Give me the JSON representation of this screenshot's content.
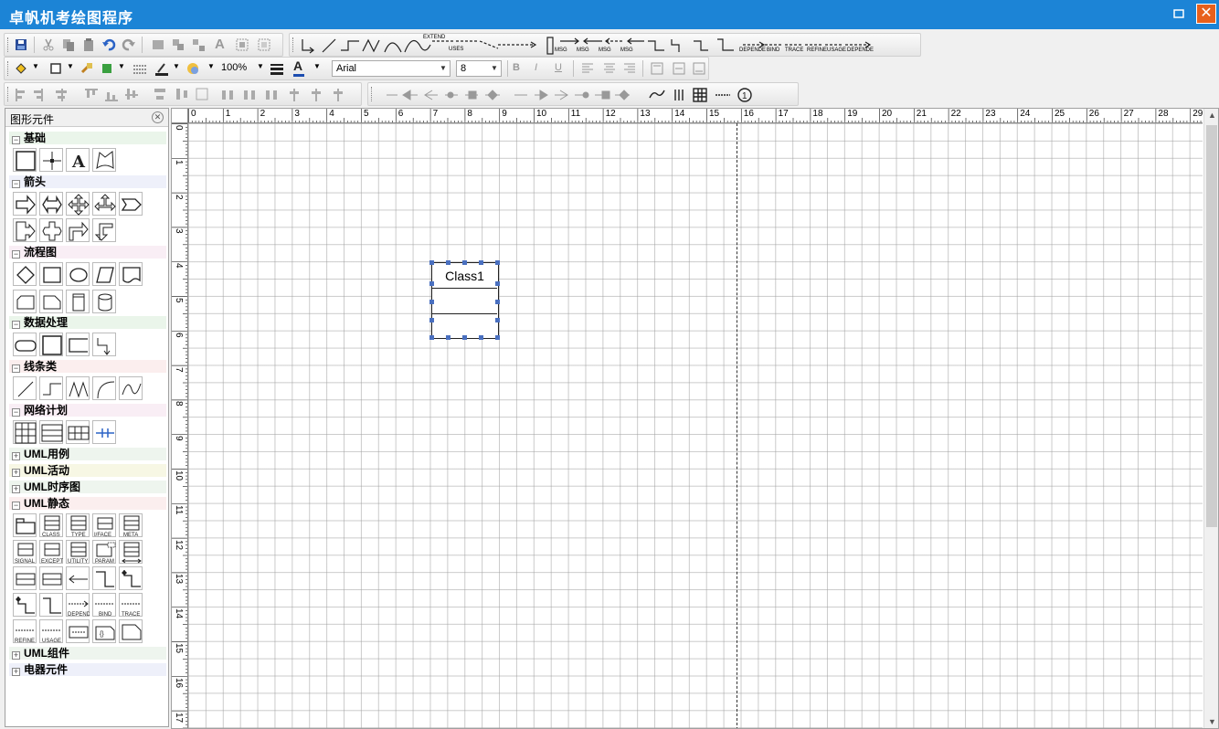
{
  "window": {
    "title": "卓帆机考绘图程序",
    "minimize_glyph": "—",
    "close_glyph": "✕"
  },
  "toolbar": {
    "zoom": "100%",
    "font_name": "Arial",
    "font_size": "8",
    "bold": "B",
    "italic": "I",
    "underline": "U",
    "text_color_glyph": "A",
    "connectors": {
      "extend": "EXTEND",
      "uses": "USES",
      "msg": "MSG",
      "depend": "DEPENDE",
      "bind": "BIND",
      "trace": "TRACE",
      "refine": "REFINE",
      "usage": "USAGE",
      "depend2": "DEPENDE"
    }
  },
  "panel": {
    "title": "图形元件",
    "close_glyph": "✕",
    "categories": [
      {
        "label": "基础",
        "expanded": true
      },
      {
        "label": "箭头",
        "expanded": true
      },
      {
        "label": "流程图",
        "expanded": true
      },
      {
        "label": "数据处理",
        "expanded": true
      },
      {
        "label": "线条类",
        "expanded": true
      },
      {
        "label": "网络计划",
        "expanded": true
      },
      {
        "label": "UML用例",
        "expanded": false
      },
      {
        "label": "UML活动",
        "expanded": false
      },
      {
        "label": "UML时序图",
        "expanded": false
      },
      {
        "label": "UML静态",
        "expanded": true
      },
      {
        "label": "UML组件",
        "expanded": false
      },
      {
        "label": "电器元件",
        "expanded": false
      }
    ],
    "expand_glyph": "+",
    "collapse_glyph": "−",
    "uml_static_labels": [
      "CLASS",
      "TYPE",
      "I/FACE",
      "META",
      "SIGNAL",
      "EXCEPT",
      "UTILITY",
      "PARAM",
      "DEPEND",
      "BIND",
      "TRACE",
      "REFINE",
      "USAGE"
    ]
  },
  "rulers": {
    "top": [
      "0",
      "1",
      "2",
      "3",
      "4",
      "5",
      "6",
      "7",
      "8",
      "9",
      "10",
      "11",
      "12",
      "13",
      "14",
      "15",
      "16",
      "17",
      "18",
      "19",
      "20",
      "21",
      "22",
      "23",
      "24",
      "25",
      "26",
      "27",
      "28",
      "29"
    ],
    "left": [
      "0",
      "1",
      "2",
      "3",
      "4",
      "5",
      "6",
      "7",
      "8",
      "9",
      "10",
      "11",
      "12",
      "13",
      "14",
      "15",
      "16",
      "17"
    ]
  },
  "canvas": {
    "class_name": "Class1"
  },
  "colors": {
    "titlebar": "#1c84d6",
    "close": "#e8601c",
    "category_bg": "#e8f0e8"
  }
}
